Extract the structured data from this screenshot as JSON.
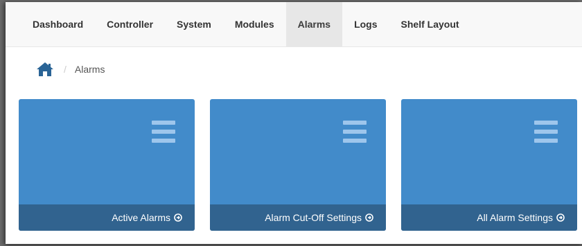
{
  "nav": {
    "items": [
      {
        "label": "Dashboard"
      },
      {
        "label": "Controller"
      },
      {
        "label": "System"
      },
      {
        "label": "Modules"
      },
      {
        "label": "Alarms"
      },
      {
        "label": "Logs"
      },
      {
        "label": "Shelf Layout"
      }
    ],
    "active": "Alarms"
  },
  "breadcrumb": {
    "home_icon": "home-icon",
    "separator": "/",
    "current": "Alarms"
  },
  "tiles": [
    {
      "label": "Active Alarms",
      "icon": "menu-icon",
      "footer_icon": "arrow-circle-right-icon"
    },
    {
      "label": "Alarm Cut-Off Settings",
      "icon": "menu-icon",
      "footer_icon": "arrow-circle-right-icon"
    },
    {
      "label": "All Alarm Settings",
      "icon": "menu-icon",
      "footer_icon": "arrow-circle-right-icon"
    }
  ],
  "colors": {
    "tile": "#428bca",
    "tile_footer": "#31638f",
    "home_icon": "#2a6496",
    "active_nav_bg": "#e7e7e7"
  }
}
